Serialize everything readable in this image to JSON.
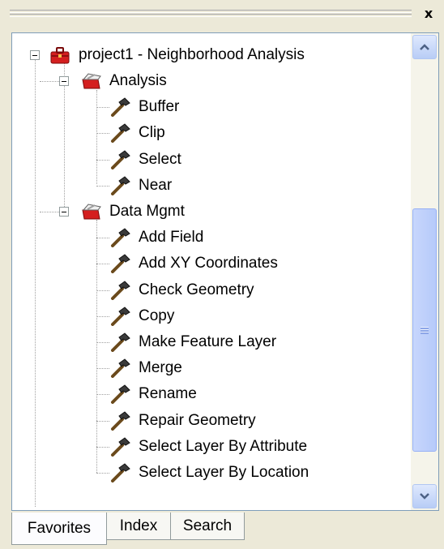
{
  "window": {
    "close_label": "x"
  },
  "tree": {
    "root": {
      "label": "project1 - Neighborhood Analysis"
    },
    "groups": [
      {
        "label": "Analysis",
        "tools": [
          "Buffer",
          "Clip",
          "Select",
          "Near"
        ]
      },
      {
        "label": "Data Mgmt",
        "tools": [
          "Add Field",
          "Add XY Coordinates",
          "Check Geometry",
          "Copy",
          "Make Feature Layer",
          "Merge",
          "Rename",
          "Repair Geometry",
          "Select Layer By Attribute",
          "Select Layer By Location"
        ]
      }
    ]
  },
  "tabs": [
    {
      "label": "Favorites",
      "active": true
    },
    {
      "label": "Index",
      "active": false
    },
    {
      "label": "Search",
      "active": false
    }
  ],
  "icons": {
    "root": "toolbox-icon",
    "group": "open-toolbox-icon",
    "tool": "hammer-icon"
  },
  "colors": {
    "background": "#ece9d8",
    "panel": "#ffffff",
    "toolbox_red": "#d41f1f",
    "scrollbar": "#c1d3fb"
  }
}
